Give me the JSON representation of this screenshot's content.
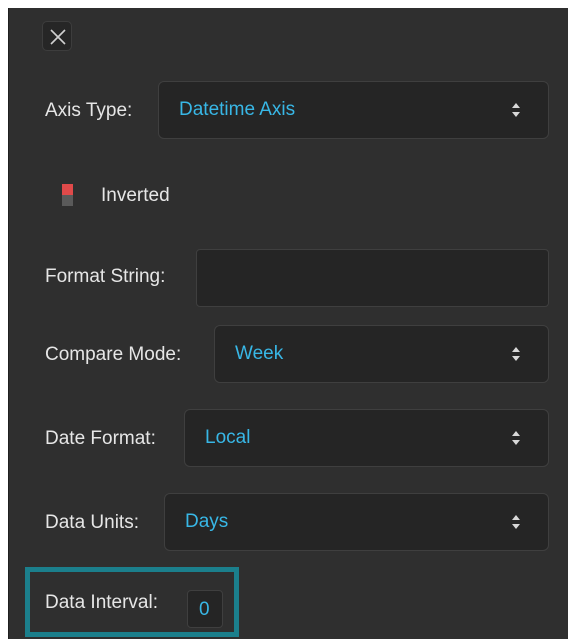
{
  "panel": {
    "close_icon": "close-x-icon",
    "axis_type": {
      "label": "Axis Type:",
      "value": "Datetime Axis"
    },
    "inverted": {
      "label": "Inverted",
      "state": "off",
      "indicator_colors": [
        "#e04a4a",
        "#5a5a5a"
      ]
    },
    "format_string": {
      "label": "Format String:",
      "value": ""
    },
    "compare_mode": {
      "label": "Compare Mode:",
      "value": "Week"
    },
    "date_format": {
      "label": "Date Format:",
      "value": "Local"
    },
    "data_units": {
      "label": "Data Units:",
      "value": "Days"
    },
    "data_interval": {
      "label": "Data Interval:",
      "value": "0"
    }
  },
  "colors": {
    "panel_bg": "#2f2f2f",
    "field_bg": "#252525",
    "accent_text": "#38b7e6",
    "highlight_border": "#1b7f8c"
  }
}
